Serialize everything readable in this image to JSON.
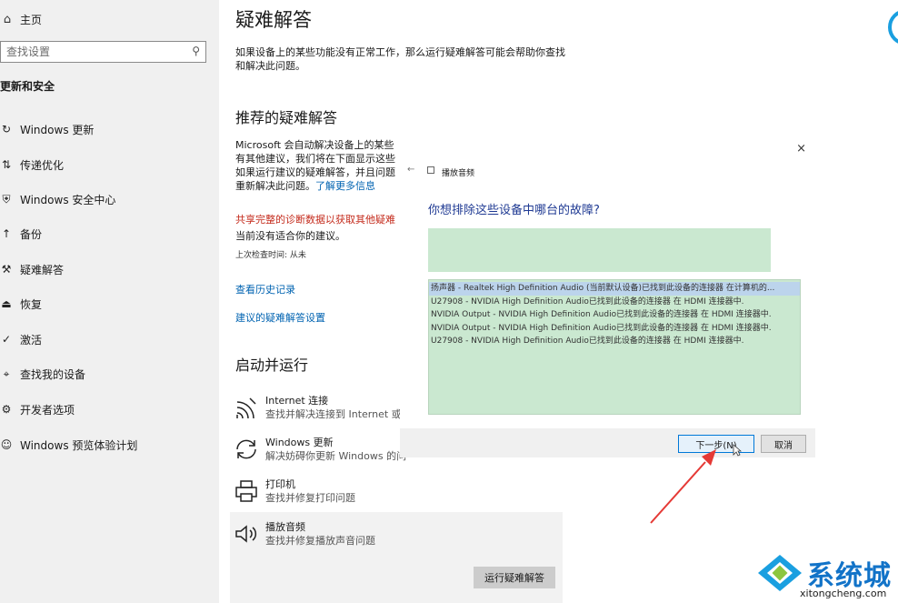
{
  "sidebar": {
    "home": "主页",
    "search_placeholder": "查找设置",
    "section": "更新和安全",
    "items": [
      {
        "label": "Windows 更新",
        "icon": "refresh-icon"
      },
      {
        "label": "传递优化",
        "icon": "delivery-icon"
      },
      {
        "label": "Windows 安全中心",
        "icon": "shield-icon"
      },
      {
        "label": "备份",
        "icon": "backup-icon"
      },
      {
        "label": "疑难解答",
        "icon": "wrench-icon"
      },
      {
        "label": "恢复",
        "icon": "recovery-icon"
      },
      {
        "label": "激活",
        "icon": "check-circle-icon"
      },
      {
        "label": "查找我的设备",
        "icon": "find-device-icon"
      },
      {
        "label": "开发者选项",
        "icon": "developer-icon"
      },
      {
        "label": "Windows 预览体验计划",
        "icon": "insider-icon"
      }
    ]
  },
  "main": {
    "title": "疑难解答",
    "desc": "如果设备上的某些功能没有正常工作，那么运行疑难解答可能会帮助你查找和解决此问题。",
    "recommended_title": "推荐的疑难解答",
    "ms_lines": [
      "Microsoft 会自动解决设备上的某些",
      "有其他建议，我们将在下面显示这些",
      "如果运行建议的疑难解答，并且问题",
      "重新解决此问题。"
    ],
    "learn_more": "了解更多信息",
    "share_link": "共享完整的诊断数据以获取其他疑难",
    "no_suggestion": "当前没有适合你的建议。",
    "last_check": "上次检查时间: 从未",
    "history_link": "查看历史记录",
    "settings_link": "建议的疑难解答设置",
    "run_title": "启动并运行",
    "run_items": [
      {
        "title": "Internet 连接",
        "desc": "查找并解决连接到 Internet 或",
        "icon": "wifi-icon"
      },
      {
        "title": "Windows 更新",
        "desc": "解决妨碍你更新 Windows 的问",
        "icon": "refresh-icon"
      },
      {
        "title": "打印机",
        "desc": "查找并修复打印问题",
        "icon": "printer-icon"
      },
      {
        "title": "播放音频",
        "desc": "查找并修复播放声音问题",
        "icon": "speaker-icon"
      }
    ],
    "run_button": "运行疑难解答"
  },
  "dialog": {
    "close": "×",
    "back": "←",
    "app_title": "播放音频",
    "question": "你想排除这些设备中哪台的故障?",
    "devices": [
      "扬声器 - Realtek High Definition Audio (当前默认设备)已找到此设备的连接器 在计算机的...",
      "U27908 - NVIDIA High Definition Audio已找到此设备的连接器 在 HDMI 连接器中.",
      "NVIDIA Output - NVIDIA High Definition Audio已找到此设备的连接器 在 HDMI 连接器中.",
      "NVIDIA Output - NVIDIA High Definition Audio已找到此设备的连接器 在 HDMI 连接器中.",
      "U27908 - NVIDIA High Definition Audio已找到此设备的连接器 在 HDMI 连接器中."
    ],
    "next_button": "下一步(N)",
    "cancel_button": "取消"
  },
  "watermark": {
    "title": "系统城",
    "url": "xitongcheng.com"
  },
  "colors": {
    "link": "#0063b1",
    "warning": "#c42b1c",
    "list_bg": "#cae8d0",
    "annotation": "#e53935",
    "brand": "#1273c8"
  }
}
